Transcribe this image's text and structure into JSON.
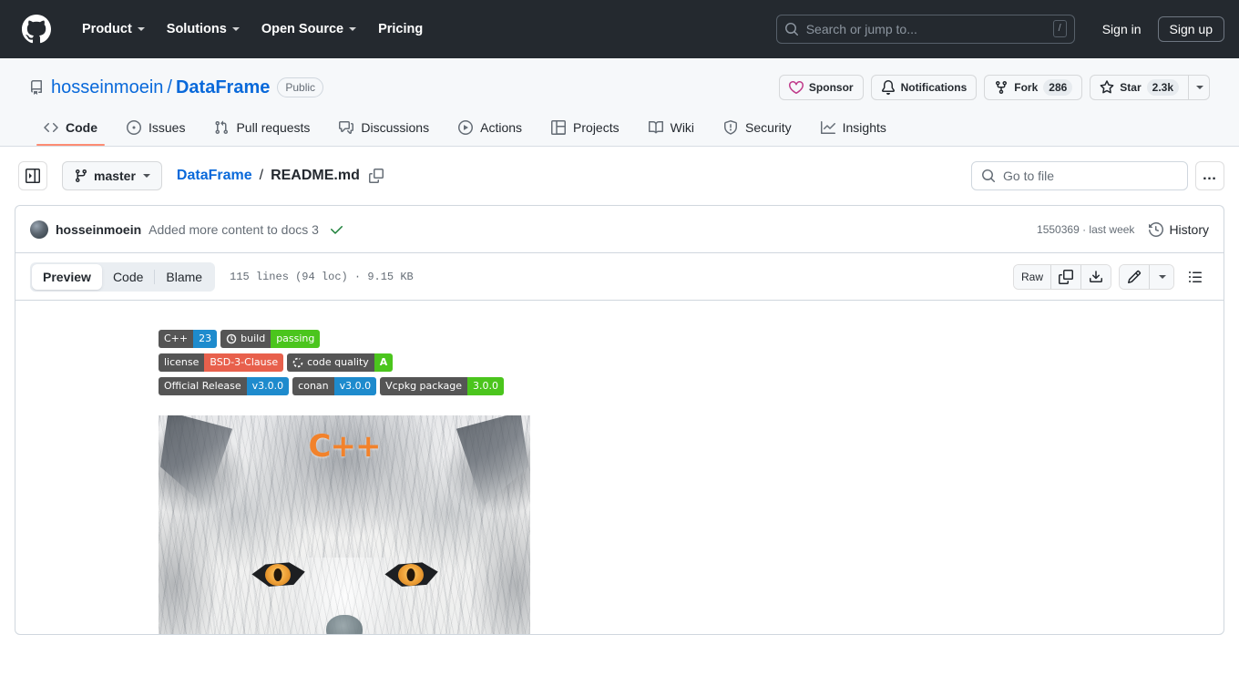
{
  "header": {
    "logo_icon": "github-mark-icon",
    "nav": [
      {
        "label": "Product",
        "has_caret": true
      },
      {
        "label": "Solutions",
        "has_caret": true
      },
      {
        "label": "Open Source",
        "has_caret": true
      },
      {
        "label": "Pricing",
        "has_caret": false
      }
    ],
    "search": {
      "placeholder": "Search or jump to...",
      "shortcut": "/",
      "icon": "search-icon"
    },
    "sign_in": "Sign in",
    "sign_up": "Sign up",
    "background_color": "#24292f"
  },
  "repo": {
    "icon": "repo-book-icon",
    "owner": "hosseinmoein",
    "separator": "/",
    "name": "DataFrame",
    "visibility": "Public",
    "actions": {
      "sponsor": {
        "label": "Sponsor",
        "icon": "heart-icon",
        "icon_color": "#bf3989"
      },
      "notifications": {
        "label": "Notifications",
        "icon": "bell-icon"
      },
      "fork": {
        "label": "Fork",
        "icon": "repo-forked-icon",
        "count": "286"
      },
      "star": {
        "label": "Star",
        "icon": "star-icon",
        "count": "2.3k"
      },
      "star_dropdown_icon": "triangle-down-icon"
    },
    "tabs": [
      {
        "label": "Code",
        "icon": "code-icon",
        "active": true
      },
      {
        "label": "Issues",
        "icon": "issue-opened-icon",
        "active": false
      },
      {
        "label": "Pull requests",
        "icon": "git-pull-request-icon",
        "active": false
      },
      {
        "label": "Discussions",
        "icon": "comment-discussion-icon",
        "active": false
      },
      {
        "label": "Actions",
        "icon": "play-icon",
        "active": false
      },
      {
        "label": "Projects",
        "icon": "table-icon",
        "active": false
      },
      {
        "label": "Wiki",
        "icon": "book-icon",
        "active": false
      },
      {
        "label": "Security",
        "icon": "shield-icon",
        "active": false
      },
      {
        "label": "Insights",
        "icon": "graph-icon",
        "active": false
      }
    ],
    "active_tab_underline_color": "#fd8c73"
  },
  "filenav": {
    "sidebar_toggle_icon": "sidebar-expand-icon",
    "branch": {
      "label": "master",
      "icon": "git-branch-icon",
      "caret": true
    },
    "breadcrumb": {
      "root": "DataFrame",
      "separator": "/",
      "file": "README.md",
      "copy_icon": "copy-icon"
    },
    "go_to_file": {
      "placeholder": "Go to file",
      "icon": "search-icon"
    },
    "more_menu": "…"
  },
  "commit": {
    "avatar": "user-avatar",
    "author": "hosseinmoein",
    "message": "Added more content to docs 3",
    "status_icon": "check-icon",
    "status_color": "#1a7f37",
    "hash_and_time": "1550369 · last week",
    "history": {
      "label": "History",
      "icon": "history-icon"
    }
  },
  "file_toolbar": {
    "views": [
      {
        "label": "Preview",
        "active": true
      },
      {
        "label": "Code",
        "active": false
      },
      {
        "label": "Blame",
        "active": false
      }
    ],
    "meta": "115 lines (94 loc) · 9.15 KB",
    "raw_label": "Raw",
    "copy_icon": "copy-icon",
    "download_icon": "download-icon",
    "edit_icon": "pencil-icon",
    "edit_caret_icon": "triangle-down-icon",
    "outline_icon": "list-unordered-icon"
  },
  "readme": {
    "badges": [
      [
        {
          "label": "C++",
          "value": "23",
          "label_bg": "#555555",
          "value_bg": "#1e8bcd",
          "icon": null
        },
        {
          "label": "build",
          "value": "passing",
          "label_bg": "#555555",
          "value_bg": "#4bc51d",
          "icon": "travis-icon"
        }
      ],
      [
        {
          "label": "license",
          "value": "BSD-3-Clause",
          "label_bg": "#555555",
          "value_bg": "#e8604c",
          "icon": null
        },
        {
          "label": "code quality",
          "value": "A",
          "label_bg": "#555555",
          "value_bg": "#4bc51d",
          "icon": "codefactor-icon"
        }
      ],
      [
        {
          "label": "Official Release",
          "value": "v3.0.0",
          "label_bg": "#555555",
          "value_bg": "#1e8bcd",
          "icon": null
        },
        {
          "label": "conan",
          "value": "v3.0.0",
          "label_bg": "#555555",
          "value_bg": "#1e8bcd",
          "icon": null
        },
        {
          "label": "Vcpkg package",
          "value": "3.0.0",
          "label_bg": "#555555",
          "value_bg": "#4bc51d",
          "icon": null
        }
      ]
    ],
    "hero_image": {
      "name": "dataframe-wolf-logo",
      "overlay_text": "C++",
      "overlay_color": "#f2822b",
      "alt": "White wolf head illustration with C++ text"
    }
  }
}
